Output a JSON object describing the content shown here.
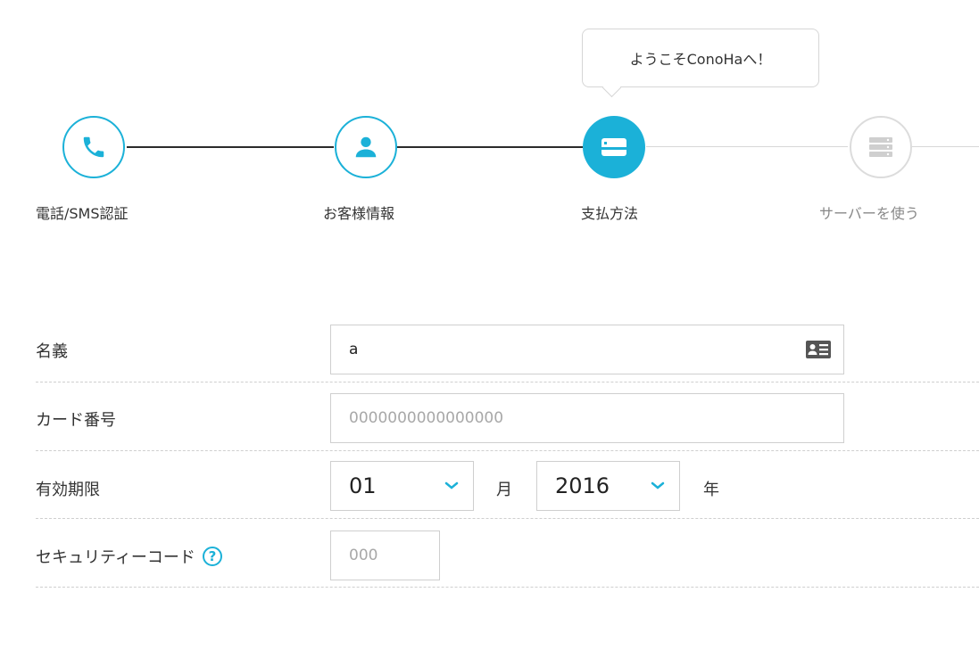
{
  "tooltip": {
    "text": "ようこそConoHaへ！"
  },
  "steps": [
    {
      "label": "電話/SMS認証",
      "state": "done",
      "icon": "phone-icon"
    },
    {
      "label": "お客様情報",
      "state": "done",
      "icon": "user-icon"
    },
    {
      "label": "支払方法",
      "state": "active",
      "icon": "credit-card-icon"
    },
    {
      "label": "サーバーを使う",
      "state": "pending",
      "icon": "server-icon"
    }
  ],
  "form": {
    "name": {
      "label": "名義",
      "value": "a",
      "icon": "contact-card-icon"
    },
    "card_number": {
      "label": "カード番号",
      "placeholder": "0000000000000000"
    },
    "expiry": {
      "label": "有効期限",
      "month": "01",
      "month_unit": "月",
      "year": "2016",
      "year_unit": "年"
    },
    "security_code": {
      "label": "セキュリティーコード",
      "help": "?",
      "placeholder": "000"
    }
  },
  "colors": {
    "accent": "#1bb1d8",
    "line_dark": "#2b2b2b",
    "line_light": "#d8d8d8"
  }
}
